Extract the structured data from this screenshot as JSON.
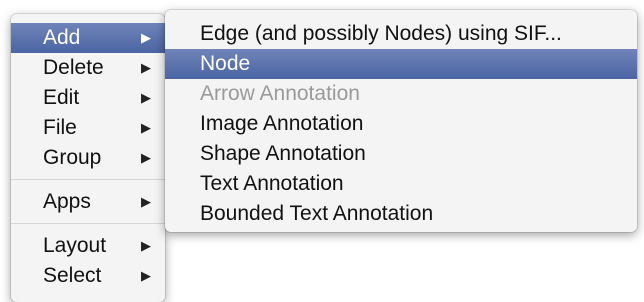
{
  "main_menu": {
    "groups": [
      [
        {
          "label": "Add",
          "selected": true
        },
        {
          "label": "Delete"
        },
        {
          "label": "Edit"
        },
        {
          "label": "File"
        },
        {
          "label": "Group"
        }
      ],
      [
        {
          "label": "Apps"
        }
      ],
      [
        {
          "label": "Layout"
        },
        {
          "label": "Select"
        }
      ]
    ],
    "submenu_arrow": "▶"
  },
  "submenu": {
    "items": [
      {
        "label": "Edge (and possibly Nodes) using SIF..."
      },
      {
        "label": "Node",
        "selected": true
      },
      {
        "label": "Arrow Annotation",
        "disabled": true
      },
      {
        "label": "Image Annotation"
      },
      {
        "label": "Shape Annotation"
      },
      {
        "label": "Text Annotation"
      },
      {
        "label": "Bounded Text Annotation"
      }
    ]
  },
  "colors": {
    "selection": "#5a72ae",
    "menu_background": "#f4f4f4",
    "disabled_text": "#9a9a9a"
  }
}
